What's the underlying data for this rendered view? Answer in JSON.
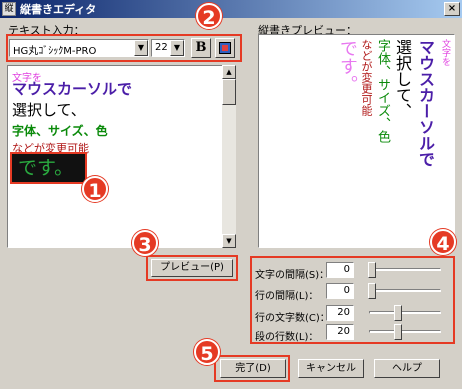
{
  "window": {
    "title": "縦書きエディタ",
    "close_label": "×"
  },
  "labels": {
    "text_input": "テキスト入力：",
    "preview": "縦書きプレビュー："
  },
  "toolbar": {
    "font": "HG丸ｺﾞｼｯｸM-PRO",
    "size": "22",
    "bold_label": "B",
    "dropdown_arrow": "▼"
  },
  "editor": {
    "lines": [
      "文字を",
      "マウスカーソルで",
      "選択して、",
      "字体、サイズ、色",
      "などが変更可能",
      "です。"
    ]
  },
  "preview": {
    "columns": [
      "文字を",
      "マウスカーソルで",
      "選択して、",
      "字体、サイズ、色",
      "などが変更可能",
      "です。"
    ]
  },
  "buttons": {
    "preview": "プレビュー(P)",
    "done": "完了(D)",
    "cancel": "キャンセル",
    "help": "ヘルプ"
  },
  "settings": [
    {
      "label": "文字の間隔(S)：",
      "value": "0"
    },
    {
      "label": "行の間隔(L)：",
      "value": "0"
    },
    {
      "label": "行の文字数(C)：",
      "value": "20"
    },
    {
      "label": "段の行数(L)：",
      "value": "20"
    }
  ],
  "badges": [
    "1",
    "2",
    "3",
    "4",
    "5"
  ],
  "colors": {
    "accent": "#e53a24",
    "titlebar": "#0a246a"
  },
  "icons": {
    "close": "close-icon",
    "color": "color-picker-icon"
  }
}
